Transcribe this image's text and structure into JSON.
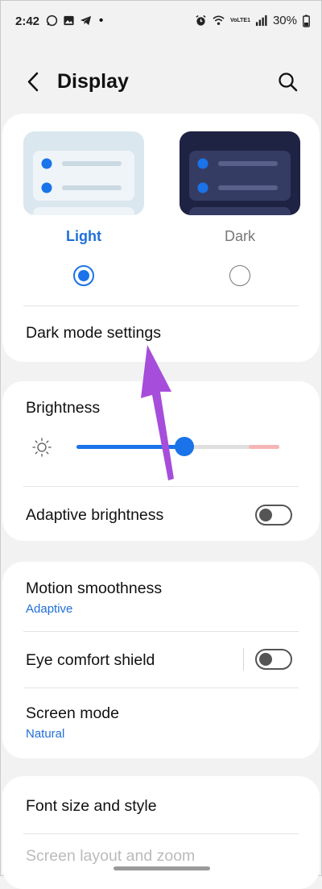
{
  "status_bar": {
    "time": "2:42",
    "dot": "•",
    "battery": "30%",
    "network_label": "VoLTE1"
  },
  "header": {
    "title": "Display"
  },
  "theme": {
    "light_label": "Light",
    "dark_label": "Dark",
    "selected": "light",
    "dark_mode_settings": "Dark mode settings"
  },
  "brightness": {
    "label": "Brightness",
    "level_percent": 53,
    "adaptive_label": "Adaptive brightness",
    "adaptive_on": false
  },
  "motion": {
    "label": "Motion smoothness",
    "value": "Adaptive"
  },
  "eye_comfort": {
    "label": "Eye comfort shield",
    "on": false
  },
  "screen_mode": {
    "label": "Screen mode",
    "value": "Natural"
  },
  "font": {
    "label": "Font size and style"
  },
  "screen_layout": {
    "label": "Screen layout and zoom"
  },
  "colors": {
    "accent": "#1a73e8",
    "arrow": "#a64ddb",
    "dark_preview": "#1e2344",
    "light_preview": "#dbe7ef"
  }
}
